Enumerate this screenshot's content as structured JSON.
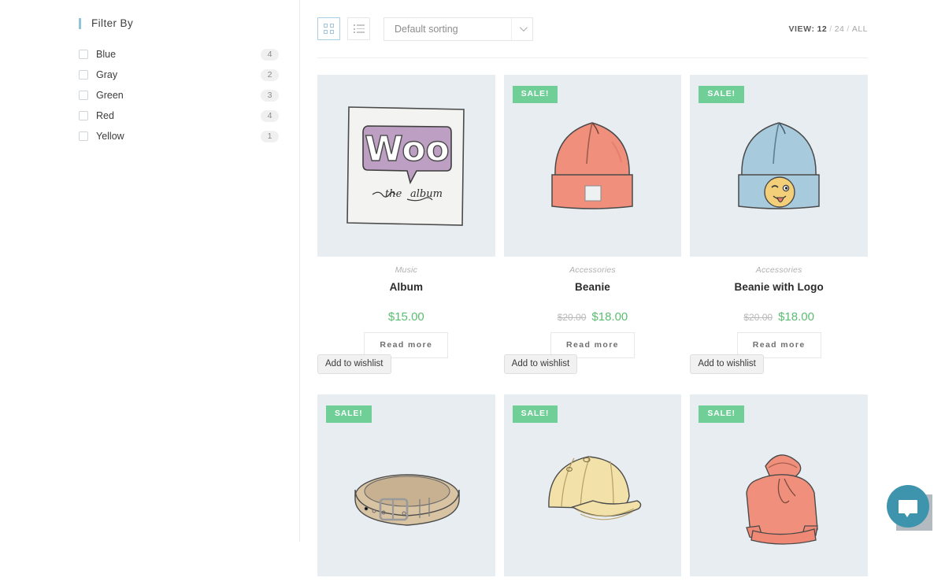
{
  "sidebar": {
    "widget_title": "Filter By",
    "accent_color": "#8ec5dd",
    "filters": [
      {
        "label": "Blue",
        "count": "4"
      },
      {
        "label": "Gray",
        "count": "2"
      },
      {
        "label": "Green",
        "count": "3"
      },
      {
        "label": "Red",
        "count": "4"
      },
      {
        "label": "Yellow",
        "count": "1"
      }
    ]
  },
  "toolbar": {
    "grid_view_icon": "grid-view-icon",
    "list_view_icon": "list-view-icon",
    "sorting": {
      "selected": "Default sorting",
      "chevron_icon": "chevron-down-icon"
    },
    "view": {
      "label": "VIEW:",
      "options": [
        "12",
        "24",
        "ALL"
      ],
      "active": "12",
      "separator": "/"
    }
  },
  "products": [
    {
      "badge": "",
      "category": "Music",
      "name": "Album",
      "price": "$15.00",
      "old_price": "",
      "action": "Read more",
      "wishlist": "Add to wishlist",
      "image": "album-cover-woo"
    },
    {
      "badge": "SALE!",
      "category": "Accessories",
      "name": "Beanie",
      "price": "$18.00",
      "old_price": "$20.00",
      "action": "Read more",
      "wishlist": "Add to wishlist",
      "image": "beanie-salmon"
    },
    {
      "badge": "SALE!",
      "category": "Accessories",
      "name": "Beanie with Logo",
      "price": "$18.00",
      "old_price": "$20.00",
      "action": "Read more",
      "wishlist": "Add to wishlist",
      "image": "beanie-blue-emoji"
    },
    {
      "badge": "SALE!",
      "category": "",
      "name": "",
      "price": "",
      "old_price": "",
      "action": "",
      "wishlist": "",
      "image": "belt-tan"
    },
    {
      "badge": "SALE!",
      "category": "",
      "name": "",
      "price": "",
      "old_price": "",
      "action": "",
      "wishlist": "",
      "image": "cap-yellow"
    },
    {
      "badge": "SALE!",
      "category": "",
      "name": "",
      "price": "",
      "old_price": "",
      "action": "",
      "wishlist": "",
      "image": "hoodie-salmon"
    }
  ],
  "chat_widget": {
    "icon": "chat-bubble-icon",
    "color": "#3e94ac"
  },
  "colors": {
    "sale_badge": "#6fcf97",
    "price": "#5bbd72",
    "thumb_bg": "#e8edf1",
    "active_border": "#a8cfe3"
  }
}
